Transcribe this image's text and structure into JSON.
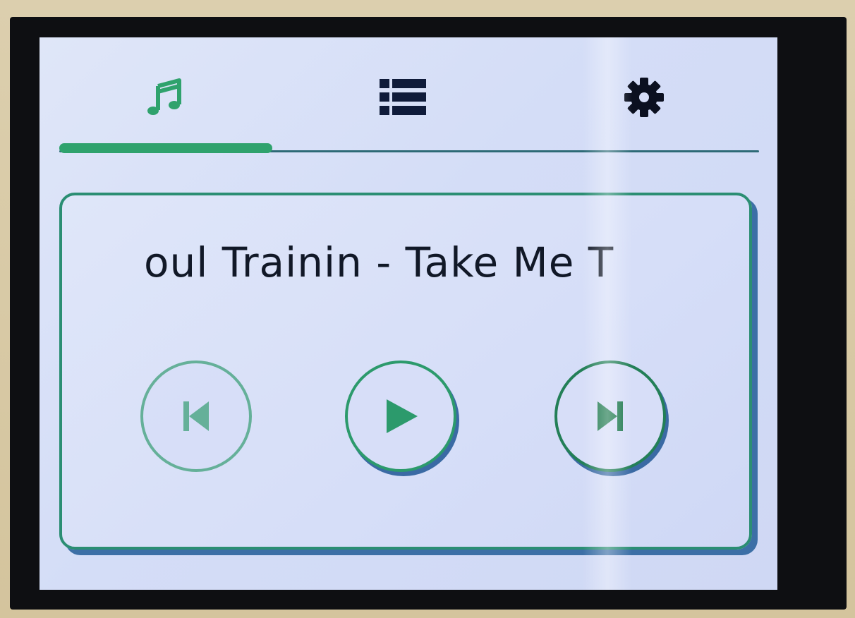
{
  "tabs": [
    {
      "id": "music",
      "icon": "music-note-icon",
      "active": true
    },
    {
      "id": "playlist",
      "icon": "list-icon",
      "active": false
    },
    {
      "id": "settings",
      "icon": "gear-icon",
      "active": false
    }
  ],
  "player": {
    "track_title": "oul Trainin - Take Me T",
    "controls": {
      "previous": "skip-previous-icon",
      "play": "play-icon",
      "next": "skip-next-icon"
    }
  },
  "colors": {
    "accent": "#2fa26d",
    "icon_dark": "#0f1b3a",
    "screen_bg": "#d6def8",
    "card_border": "#2b8e73",
    "card_shadow": "#3c6fa6"
  }
}
